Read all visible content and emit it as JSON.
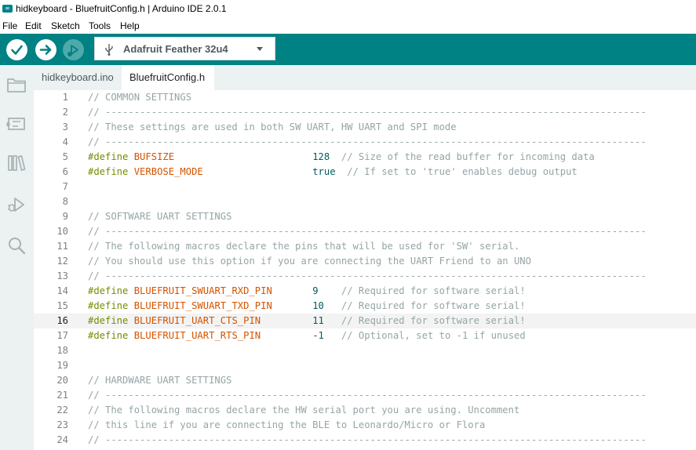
{
  "window": {
    "title": "hidkeyboard - BluefruitConfig.h | Arduino IDE 2.0.1",
    "icon_text": "∞"
  },
  "menubar": {
    "items": [
      "File",
      "Edit",
      "Sketch",
      "Tools",
      "Help"
    ]
  },
  "toolbar": {
    "verify_icon": "checkmark-icon",
    "upload_icon": "arrow-right-icon",
    "debug_icon": "debug-icon",
    "board": "Adafruit Feather 32u4",
    "accent_color": "#008184"
  },
  "sidebar": {
    "icons": [
      "folder-icon",
      "board-icon",
      "library-icon",
      "debug-icon",
      "search-icon"
    ]
  },
  "tabs": [
    {
      "label": "hidkeyboard.ino",
      "active": false
    },
    {
      "label": "BluefruitConfig.h",
      "active": true
    }
  ],
  "editor": {
    "current_line": 16,
    "lines": [
      {
        "n": "1",
        "text": "// COMMON SETTINGS"
      },
      {
        "n": "2",
        "text": "// ----------------------------------------------------------------------------------------------"
      },
      {
        "n": "3",
        "text": "// These settings are used in both SW UART, HW UART and SPI mode"
      },
      {
        "n": "4",
        "text": "// ----------------------------------------------------------------------------------------------"
      },
      {
        "n": "5",
        "kw": "#define",
        "name": "BUFSIZE",
        "pad1": "                        ",
        "value": "128",
        "pad2": "  ",
        "comment": "// Size of the read buffer for incoming data"
      },
      {
        "n": "6",
        "kw": "#define",
        "name": "VERBOSE_MODE",
        "pad1": "                   ",
        "value": "true",
        "pad2": "  ",
        "comment": "// If set to 'true' enables debug output"
      },
      {
        "n": "7",
        "text": ""
      },
      {
        "n": "8",
        "text": ""
      },
      {
        "n": "9",
        "text": "// SOFTWARE UART SETTINGS"
      },
      {
        "n": "10",
        "text": "// ----------------------------------------------------------------------------------------------"
      },
      {
        "n": "11",
        "text": "// The following macros declare the pins that will be used for 'SW' serial."
      },
      {
        "n": "12",
        "text": "// You should use this option if you are connecting the UART Friend to an UNO"
      },
      {
        "n": "13",
        "text": "// ----------------------------------------------------------------------------------------------"
      },
      {
        "n": "14",
        "kw": "#define",
        "name": "BLUEFRUIT_SWUART_RXD_PIN",
        "pad1": "       ",
        "value": "9",
        "pad2": "    ",
        "comment": "// Required for software serial!"
      },
      {
        "n": "15",
        "kw": "#define",
        "name": "BLUEFRUIT_SWUART_TXD_PIN",
        "pad1": "       ",
        "value": "10",
        "pad2": "   ",
        "comment": "// Required for software serial!"
      },
      {
        "n": "16",
        "kw": "#define",
        "name": "BLUEFRUIT_UART_CTS_PIN",
        "pad1": "         ",
        "value": "11",
        "pad2": "   ",
        "comment": "// Required for software serial!"
      },
      {
        "n": "17",
        "kw": "#define",
        "name": "BLUEFRUIT_UART_RTS_PIN",
        "pad1": "         ",
        "value": "-1",
        "pad2": "   ",
        "comment": "// Optional, set to -1 if unused"
      },
      {
        "n": "18",
        "text": ""
      },
      {
        "n": "19",
        "text": ""
      },
      {
        "n": "20",
        "text": "// HARDWARE UART SETTINGS"
      },
      {
        "n": "21",
        "text": "// ----------------------------------------------------------------------------------------------"
      },
      {
        "n": "22",
        "text": "// The following macros declare the HW serial port you are using. Uncomment"
      },
      {
        "n": "23",
        "text": "// this line if you are connecting the BLE to Leonardo/Micro or Flora"
      },
      {
        "n": "24",
        "text": "// ----------------------------------------------------------------------------------------------"
      }
    ]
  }
}
